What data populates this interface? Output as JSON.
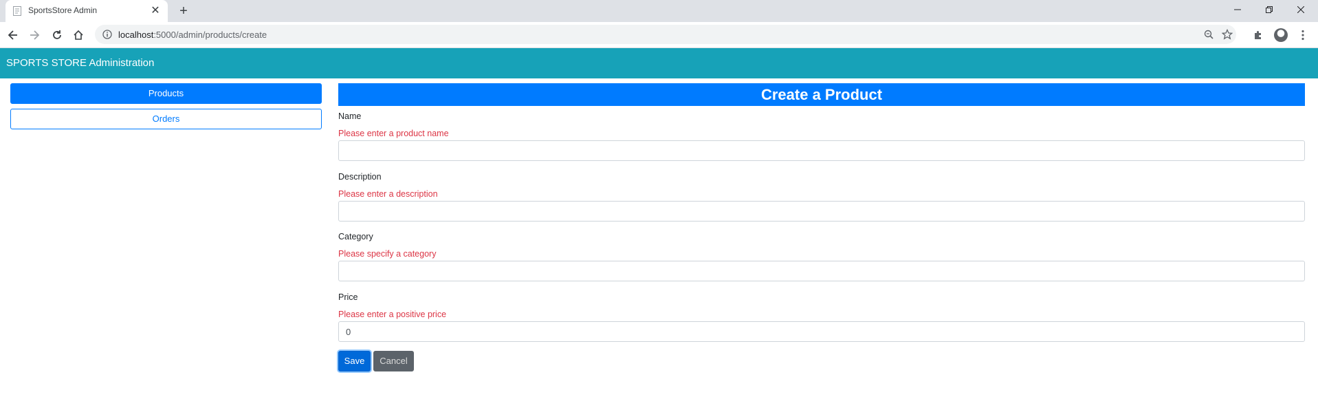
{
  "browser": {
    "tab_title": "SportsStore Admin",
    "tab_close_glyph": "✕",
    "new_tab_glyph": "+",
    "url_host": "localhost",
    "url_path": ":5000/admin/products/create",
    "icons": {
      "favicon": "page-icon",
      "back": "back-arrow-icon",
      "forward": "forward-arrow-icon",
      "reload": "reload-icon",
      "home": "home-icon",
      "site_info": "info-icon",
      "zoom": "zoom-icon",
      "bookmark": "star-icon",
      "extensions": "puzzle-icon",
      "profile": "avatar",
      "menu": "kebab-menu-icon"
    }
  },
  "navbar": {
    "brand": "SPORTS STORE Administration",
    "color": "#17a2b8"
  },
  "sidebar": {
    "items": [
      {
        "label": "Products",
        "active": true
      },
      {
        "label": "Orders",
        "active": false
      }
    ]
  },
  "form": {
    "title": "Create a Product",
    "fields": [
      {
        "label": "Name",
        "error": "Please enter a product name",
        "value": ""
      },
      {
        "label": "Description",
        "error": "Please enter a description",
        "value": ""
      },
      {
        "label": "Category",
        "error": "Please specify a category",
        "value": ""
      },
      {
        "label": "Price",
        "error": "Please enter a positive price",
        "value": "0"
      }
    ],
    "save_label": "Save",
    "cancel_label": "Cancel"
  },
  "colors": {
    "primary": "#007bff",
    "error": "#dc3545",
    "secondary": "#6c757d"
  }
}
